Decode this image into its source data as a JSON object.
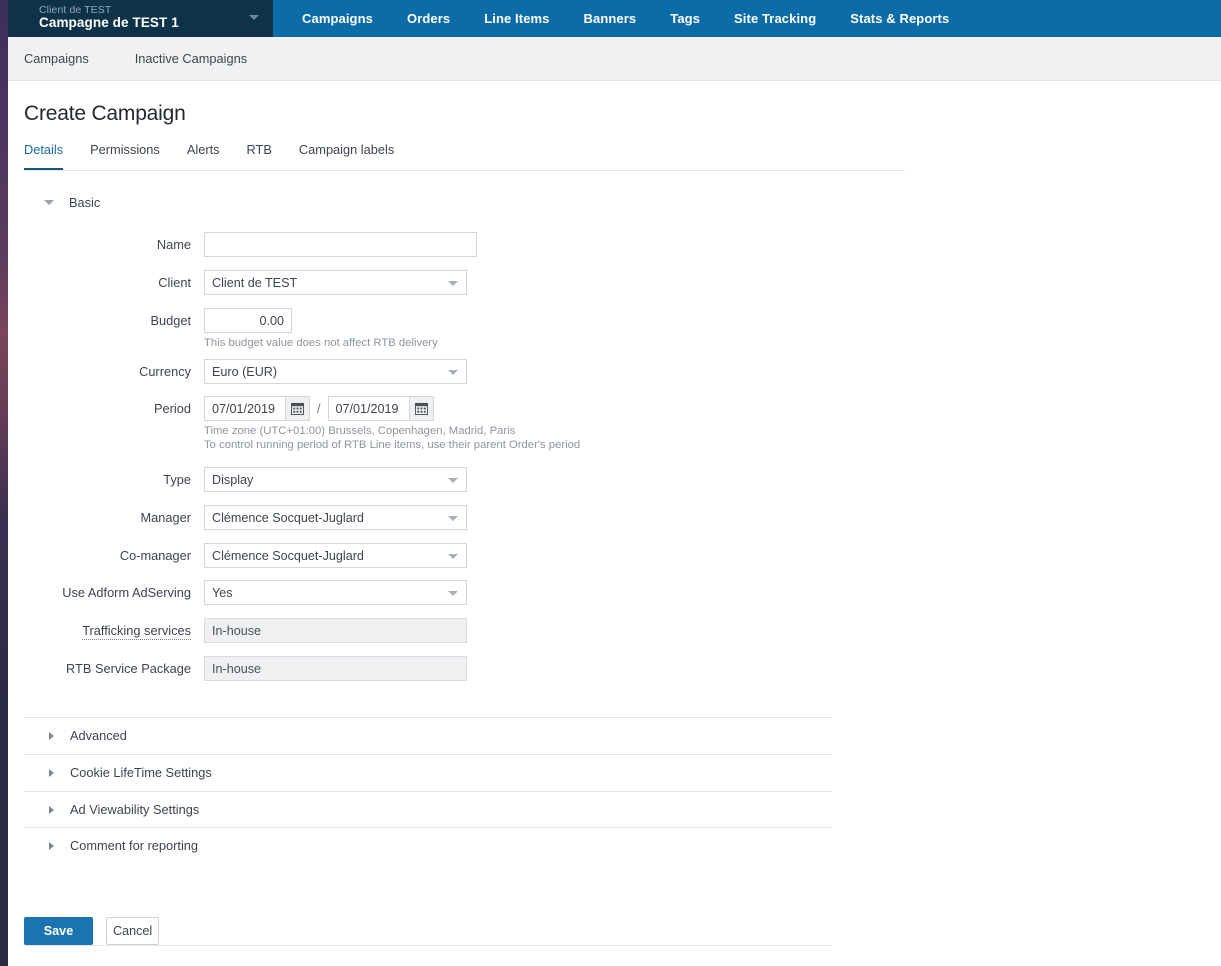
{
  "topbar": {
    "context": {
      "client_label": "Client de TEST",
      "campaign_label": "Campagne de TEST 1",
      "caret_icon": "chevron-down-icon"
    },
    "nav": [
      {
        "label": "Campaigns"
      },
      {
        "label": "Orders"
      },
      {
        "label": "Line Items"
      },
      {
        "label": "Banners"
      },
      {
        "label": "Tags"
      },
      {
        "label": "Site Tracking"
      },
      {
        "label": "Stats & Reports"
      }
    ]
  },
  "subnav": {
    "items": [
      {
        "label": "Campaigns"
      },
      {
        "label": "Inactive Campaigns"
      }
    ]
  },
  "page": {
    "title": "Create Campaign",
    "tabs": [
      {
        "label": "Details",
        "active": true
      },
      {
        "label": "Permissions",
        "active": false
      },
      {
        "label": "Alerts",
        "active": false
      },
      {
        "label": "RTB",
        "active": false
      },
      {
        "label": "Campaign labels",
        "active": false
      }
    ]
  },
  "basic": {
    "section_label": "Basic",
    "toggle_icon": "triangle-down-icon",
    "fields": {
      "name": {
        "label": "Name",
        "value": "",
        "placeholder": ""
      },
      "client": {
        "label": "Client",
        "value": "Client de TEST"
      },
      "budget": {
        "label": "Budget",
        "value": "0.00",
        "hint": "This budget value does not affect RTB delivery"
      },
      "currency": {
        "label": "Currency",
        "value": "Euro (EUR)"
      },
      "period": {
        "label": "Period",
        "start": "07/01/2019",
        "end": "07/01/2019",
        "separator": "/",
        "calendar_icon": "calendar-icon",
        "hint1": "Time zone (UTC+01:00) Brussels, Copenhagen, Madrid, Paris",
        "hint2": "To control running period of RTB Line items, use their parent Order's period"
      },
      "type": {
        "label": "Type",
        "value": "Display"
      },
      "manager": {
        "label": "Manager",
        "value": "Clémence Socquet-Juglard"
      },
      "comanager": {
        "label": "Co-manager",
        "value": "Clémence Socquet-Juglard"
      },
      "adserving": {
        "label": "Use Adform AdServing",
        "value": "Yes"
      },
      "trafficking": {
        "label": "Trafficking services",
        "value": "In-house"
      },
      "rtbpackage": {
        "label": "RTB Service Package",
        "value": "In-house"
      }
    }
  },
  "collapsible_sections": [
    {
      "label": "Advanced",
      "icon": "triangle-right-icon"
    },
    {
      "label": "Cookie LifeTime Settings",
      "icon": "triangle-right-icon"
    },
    {
      "label": "Ad Viewability Settings",
      "icon": "triangle-right-icon"
    },
    {
      "label": "Comment for reporting",
      "icon": "triangle-right-icon"
    }
  ],
  "actions": {
    "save_label": "Save",
    "cancel_label": "Cancel"
  },
  "colors": {
    "topbar_blue": "#0b6ca8",
    "context_navy": "#0e3349",
    "accent_link": "#1b6ba6",
    "tab_underline": "#14577f",
    "primary_button": "#1b73b0",
    "subnav_bg": "#f0f1f3",
    "readonly_bg": "#eef0f2"
  }
}
